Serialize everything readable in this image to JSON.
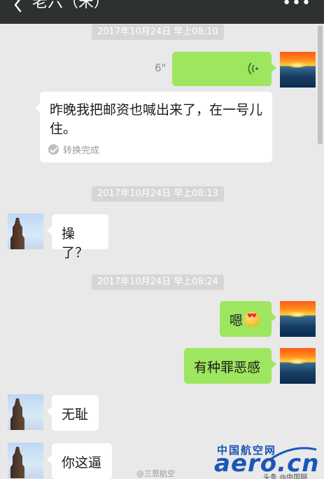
{
  "header": {
    "title": "老六（宋）",
    "more": "•••"
  },
  "timestamps": [
    "2017年10月24日 早上08:10",
    "2017年10月24日 早上08:13",
    "2017年10月24日 早上08:24"
  ],
  "messages": {
    "voice": {
      "duration": "6\""
    },
    "transcript": {
      "text": "昨晚我把邮资也喊出来了，在一号儿住。",
      "status": "转换完成"
    },
    "m1": "操了？",
    "m2": "嗯",
    "m3": "有种罪恶感",
    "m4": "无耻",
    "m5": "你这逼"
  },
  "watermark": {
    "cn": "中国航空网",
    "aero": "aero.cn",
    "weibo": "@三思航空",
    "toutiao": "头条 @中国网"
  },
  "colors": {
    "topbar": "#2e3132",
    "background": "#e9e9e9",
    "sent_bubble": "#9fe660",
    "received_bubble": "#ffffff",
    "timestamp_bg": "#d6d6d6",
    "watermark_blue": "#1a56b8"
  },
  "icons": {
    "back": "chevron-left-icon",
    "more": "more-dots-icon",
    "voice": "voice-wave-icon",
    "check": "check-circle-icon",
    "emoji": "heart-eyes-emoji"
  }
}
